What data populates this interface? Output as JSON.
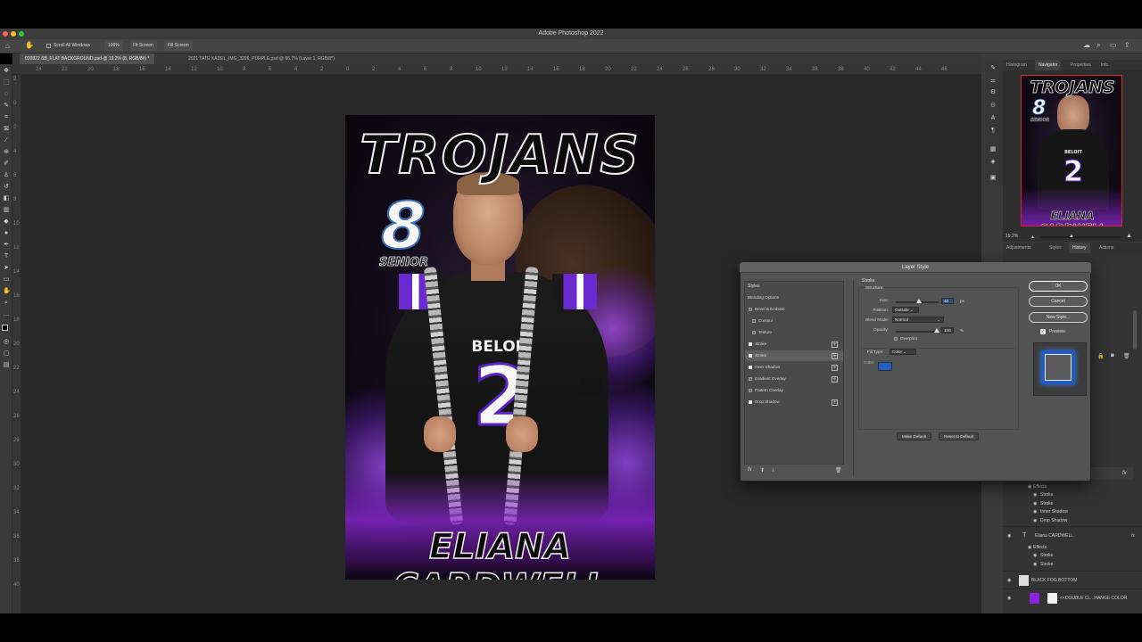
{
  "app": {
    "title": "Adobe Photoshop 2022"
  },
  "options_bar": {
    "scroll_all_windows": "Scroll All Windows",
    "zoom": "100%",
    "fit_screen": "Fit Screen",
    "fill_screen": "Fill Screen"
  },
  "doc_tabs": [
    {
      "label": "020822 SB_FLAT BACKGROUND.psd @ 19.2% (8, RGB/8#) *"
    },
    {
      "label": "2021 TATE KADEL_IMG_3206_PURPLE.psd @ 66.7% (Layer 1, RGB/8*)"
    }
  ],
  "ruler_h": [
    "24",
    "22",
    "20",
    "18",
    "16",
    "14",
    "12",
    "10",
    "8",
    "6",
    "4",
    "2",
    "0",
    "2",
    "4",
    "6",
    "8",
    "10",
    "12",
    "14",
    "16",
    "18",
    "20",
    "22",
    "24",
    "26",
    "28",
    "30",
    "32",
    "34",
    "36",
    "38",
    "40",
    "42",
    "44",
    "46"
  ],
  "ruler_v": [
    "2",
    "0",
    "2",
    "4",
    "6",
    "8",
    "10",
    "12",
    "14",
    "16",
    "18",
    "20",
    "22",
    "24",
    "26",
    "28",
    "30",
    "32",
    "34",
    "36",
    "38",
    "40"
  ],
  "poster": {
    "title": "TROJANS",
    "number": "8",
    "class": "SENIOR",
    "team": "BELOIT",
    "jersey_number": "2",
    "name": "ELIANA CARDWELL"
  },
  "right_panel": {
    "tabs_top": [
      "Histogram",
      "Navigator",
      "Properties",
      "Info"
    ],
    "active_top": "Navigator",
    "zoom": "19.2%",
    "tabs_mid": [
      "Adjustments",
      "Styles",
      "History",
      "Actions"
    ],
    "active_mid": "History"
  },
  "layers": {
    "effects_group_1": {
      "label": "Effects",
      "items": [
        "Stroke",
        "Stroke",
        "Inner Shadow",
        "Drop Shadow"
      ]
    },
    "text_layer": {
      "name": "Eliana CARDWELL",
      "type_icon": "T",
      "fx": "fx"
    },
    "effects_group_2": {
      "label": "Effects",
      "items": [
        "Stroke",
        "Stroke"
      ]
    },
    "fog_layer": {
      "name": "BLACK FOG BOTTOM"
    },
    "color_layer": {
      "name": "<<DOUBLE CL...HANGE COLOR",
      "color": "#8a22e0"
    }
  },
  "dialog": {
    "title": "Layer Style",
    "styles_header": "Styles",
    "style_items": [
      {
        "label": "Blending Options",
        "checkbox": false,
        "checked": false,
        "plus": false
      },
      {
        "label": "Bevel & Emboss",
        "checkbox": true,
        "checked": false,
        "plus": false
      },
      {
        "label": "Contour",
        "checkbox": true,
        "checked": false,
        "plus": false,
        "indent": true
      },
      {
        "label": "Texture",
        "checkbox": true,
        "checked": false,
        "plus": false,
        "indent": true
      },
      {
        "label": "Stroke",
        "checkbox": true,
        "checked": true,
        "plus": true
      },
      {
        "label": "Stroke",
        "checkbox": true,
        "checked": true,
        "plus": true,
        "selected": true
      },
      {
        "label": "Inner Shadow",
        "checkbox": true,
        "checked": true,
        "plus": true
      },
      {
        "label": "Gradient Overlay",
        "checkbox": true,
        "checked": false,
        "plus": true
      },
      {
        "label": "Pattern Overlay",
        "checkbox": true,
        "checked": false,
        "plus": false
      },
      {
        "label": "Drop Shadow",
        "checkbox": true,
        "checked": true,
        "plus": true
      }
    ],
    "stroke": {
      "section": "Stroke",
      "subsection": "Structure",
      "size_label": "Size:",
      "size_value": "40",
      "size_unit": "px",
      "size_level": 0.55,
      "position_label": "Position:",
      "position_value": "Outside",
      "blend_label": "Blend Mode:",
      "blend_value": "Normal",
      "opacity_label": "Opacity:",
      "opacity_value": "100",
      "opacity_unit": "%",
      "overprint_label": "Overprint",
      "fill_type_label": "Fill Type:",
      "fill_type_value": "Color",
      "color_label": "Color:",
      "color": "#1f5cc8"
    },
    "make_default": "Make Default",
    "reset_default": "Reset to Default",
    "buttons": {
      "ok": "OK",
      "cancel": "Cancel",
      "new_style": "New Style..."
    },
    "preview_label": "Preview",
    "preview_checked": true
  }
}
